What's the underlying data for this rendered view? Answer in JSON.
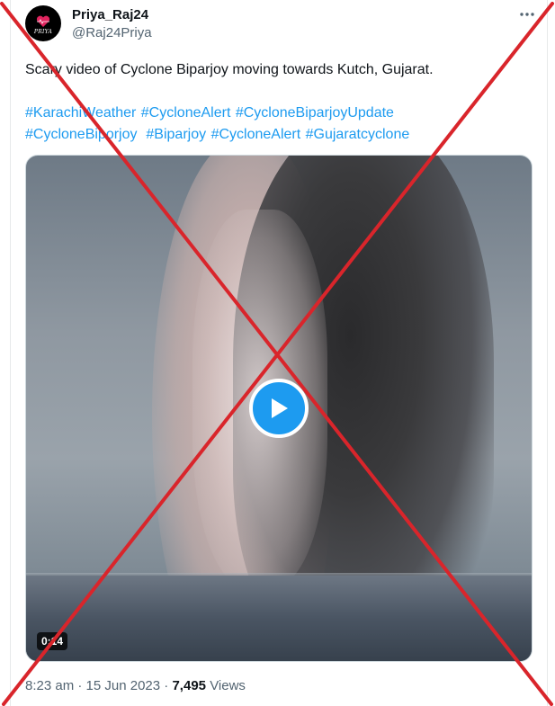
{
  "author": {
    "display_name": "Priya_Raj24",
    "handle": "@Raj24Priya",
    "avatar_text": "PRIYA",
    "avatar_icon": "heart-icon"
  },
  "more_icon": "more-horizontal-icon",
  "tweet": {
    "text": "Scary video of Cyclone Biparjoy moving towards Kutch, Gujarat.",
    "hashtags": [
      "#KarachiWeather",
      "#CycloneAlert",
      "#CycloneBiparjoyUpdate",
      "#CycloneBiporjoy",
      "#Biparjoy",
      "#CycloneAlert",
      "#Gujaratcyclone"
    ]
  },
  "media": {
    "type": "video",
    "duration": "0:14",
    "play_icon": "play-icon"
  },
  "meta": {
    "time": "8:23 am",
    "separator": "·",
    "date": "15 Jun 2023",
    "views_count": "7,495",
    "views_label": "Views"
  },
  "overlay": {
    "type": "red-cross",
    "color": "#d9252b"
  },
  "colors": {
    "link": "#1d9bf0",
    "text": "#0f1419",
    "secondary": "#536471"
  }
}
